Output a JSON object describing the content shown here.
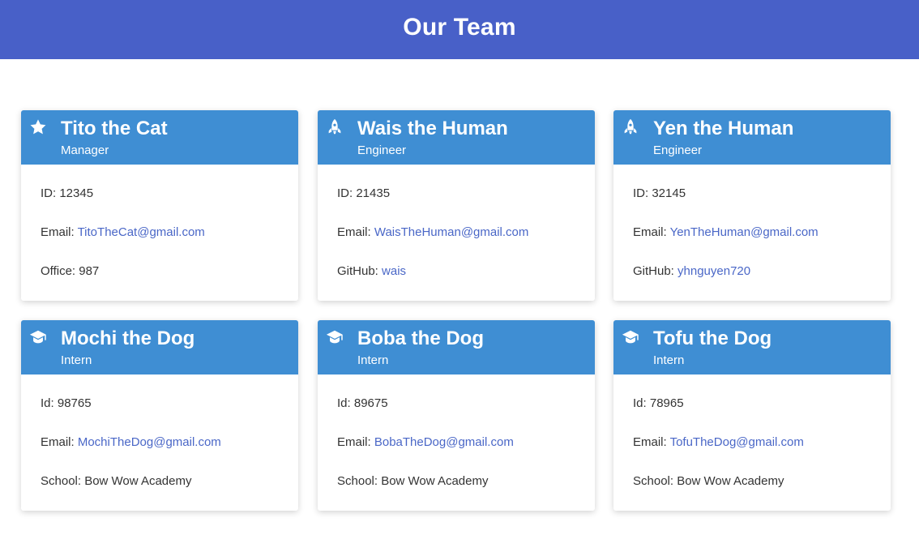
{
  "header": {
    "title": "Our Team"
  },
  "colors": {
    "header_bg": "#4860c8",
    "card_head_bg": "#3f8ed3",
    "link": "#4a67c7"
  },
  "cards": [
    {
      "name": "Tito the Cat",
      "role": "Manager",
      "icon": "star-icon",
      "row1_label": "ID: ",
      "row1_value": "12345",
      "row2_label": "Email: ",
      "row2_value": "TitoTheCat@gmail.com",
      "row3_label": "Office: ",
      "row3_value": "987"
    },
    {
      "name": "Wais the Human",
      "role": "Engineer",
      "icon": "rocket-icon",
      "row1_label": "ID: ",
      "row1_value": "21435",
      "row2_label": "Email: ",
      "row2_value": "WaisTheHuman@gmail.com",
      "row3_label": "GitHub: ",
      "row3_value": "wais"
    },
    {
      "name": "Yen the Human",
      "role": "Engineer",
      "icon": "rocket-icon",
      "row1_label": "ID: ",
      "row1_value": "32145",
      "row2_label": "Email: ",
      "row2_value": "YenTheHuman@gmail.com",
      "row3_label": "GitHub: ",
      "row3_value": "yhnguyen720"
    },
    {
      "name": "Mochi the Dog",
      "role": "Intern",
      "icon": "graduation-cap-icon",
      "row1_label": "Id: ",
      "row1_value": "98765",
      "row2_label": "Email: ",
      "row2_value": "MochiTheDog@gmail.com",
      "row3_label": "School: ",
      "row3_value": "Bow Wow Academy"
    },
    {
      "name": "Boba the Dog",
      "role": "Intern",
      "icon": "graduation-cap-icon",
      "row1_label": "Id: ",
      "row1_value": "89675",
      "row2_label": "Email: ",
      "row2_value": "BobaTheDog@gmail.com",
      "row3_label": "School: ",
      "row3_value": "Bow Wow Academy"
    },
    {
      "name": "Tofu the Dog",
      "role": "Intern",
      "icon": "graduation-cap-icon",
      "row1_label": "Id: ",
      "row1_value": "78965",
      "row2_label": "Email: ",
      "row2_value": "TofuTheDog@gmail.com",
      "row3_label": "School: ",
      "row3_value": "Bow Wow Academy"
    }
  ]
}
